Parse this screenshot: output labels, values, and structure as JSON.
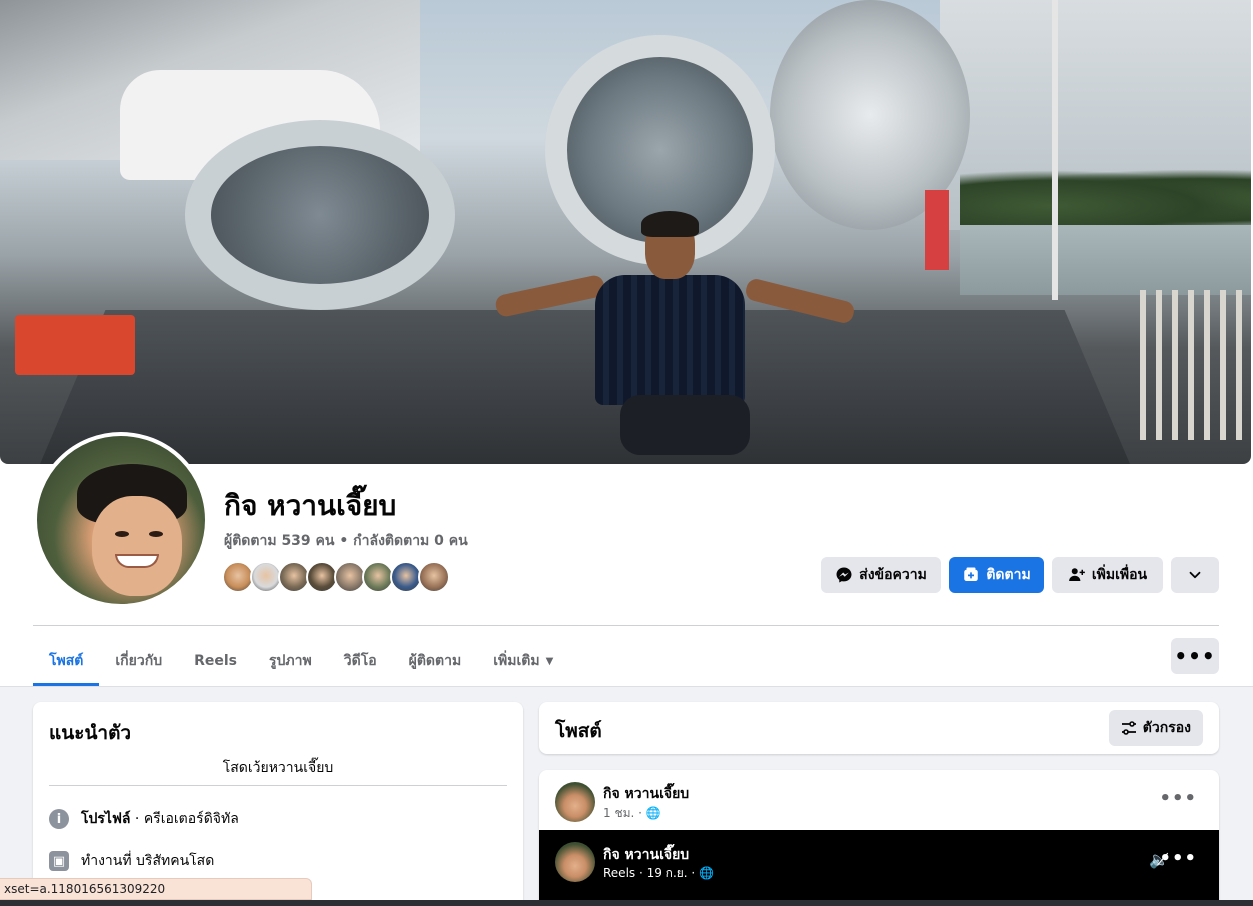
{
  "profile": {
    "name": "กิจ หวานเจี๊ยบ",
    "followers_text": "ผู้ติดตาม 539 คน • กำลังติดตาม 0 คน",
    "follower_avatar_colors": [
      "#c88e5a",
      "#d9dadc",
      "#7a6a55",
      "#5a4d3a",
      "#8b7a6a",
      "#6e7c5a",
      "#3a5b8c",
      "#9a7358"
    ]
  },
  "actions": {
    "message": "ส่งข้อความ",
    "follow": "ติดตาม",
    "add_friend": "เพิ่มเพื่อน"
  },
  "tabs": [
    {
      "label": "โพสต์",
      "active": true
    },
    {
      "label": "เกี่ยวกับ"
    },
    {
      "label": "Reels"
    },
    {
      "label": "รูปภาพ"
    },
    {
      "label": "วิดีโอ"
    },
    {
      "label": "ผู้ติดตาม"
    },
    {
      "label": "เพิ่มเติม"
    }
  ],
  "intro": {
    "title": "แนะนำตัว",
    "bio": "โสดเว้ยหวานเจี๊ยบ",
    "profile_bold": "โปรไฟล์",
    "profile_rest": " · ครีเอเตอร์ดิจิทัล",
    "work": "ทำงานที่ บริสัทคนโสด"
  },
  "posts": {
    "title": "โพสต์",
    "filter": "ตัวกรอง",
    "post": {
      "author": "กิจ หวานเจี๊ยบ",
      "meta": "1 ชม. · 🌐"
    },
    "reel": {
      "author": "กิจ หวานเจี๊ยบ",
      "meta": "Reels · 19 ก.ย. · 🌐"
    }
  },
  "status_bar": {
    "url": "xset=a.118016561309220"
  },
  "colors": {
    "accent": "#1b74e4",
    "secondary_text": "#65676b",
    "button_grey": "#e4e6eb",
    "page_bg": "#f0f2f5"
  }
}
